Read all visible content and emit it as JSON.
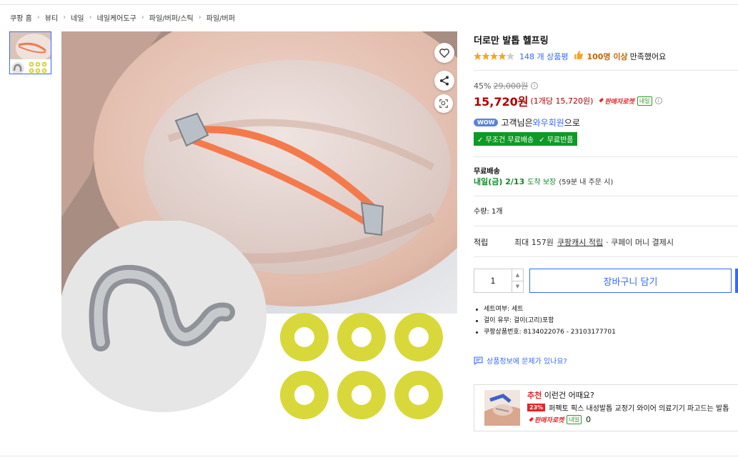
{
  "breadcrumb": {
    "items": [
      "쿠팡 홈",
      "뷰티",
      "네일",
      "네일케어도구",
      "파일/버퍼/스틱",
      "파일/버퍼"
    ]
  },
  "product": {
    "title": "더로만 발톱 헬프링",
    "rating": 4,
    "rating_max": 5,
    "review_count": "148 개 상품평",
    "satisfaction_strong": "100명 이상",
    "satisfaction_rest": "만족했어요",
    "discount_rate": "45%",
    "original_price": "29,000원",
    "sale_price": "15,720원",
    "unit_price": "(1개당 15,720원)",
    "rocket_label": "판매자로켓",
    "tomorrow_tag": "내일",
    "wow_badge": "WOW",
    "wow_text_prefix": "고객님은 ",
    "wow_link": "와우회원",
    "wow_text_suffix": "으로",
    "benefit_tags": [
      "✓ 무조건 무료배송",
      "✓ 무료반품"
    ],
    "shipping_label": "무료배송",
    "delivery_date": "내일(금) 2/13",
    "delivery_guarantee": "도착 보장",
    "delivery_note": "(59분 내 주문 시)",
    "quantity_label": "수량: 1개",
    "reward_label": "적립",
    "reward_text": "최대 157원",
    "reward_link": "쿠팡캐시 적립",
    "reward_rest": "· 쿠페이 머니 결제시",
    "quantity_value": "1",
    "cart_button": "장바구니 담기",
    "specs": [
      "세트여부: 세트",
      "걸이 유무: 걸이(고리)포함",
      "쿠팡상품번호: 8134022076 - 23103177701"
    ],
    "report_link": "상품정보에 문제가 있나요?"
  },
  "recommend": {
    "title_red": "추천",
    "title_rest": " 이런건 어때요?",
    "discount": "23%",
    "name": "퍼펙토 픽스 내성발톱 교정기 와이어 의료기기 파고드는 발톱",
    "rocket_label": "판매자로켓",
    "tomorrow_tag": "내일",
    "review_count": "0"
  },
  "colors": {
    "accent": "#346aff",
    "price": "#ae0000",
    "rocket": "#e52528",
    "green": "#0e9a26",
    "star": "#f5a623"
  }
}
